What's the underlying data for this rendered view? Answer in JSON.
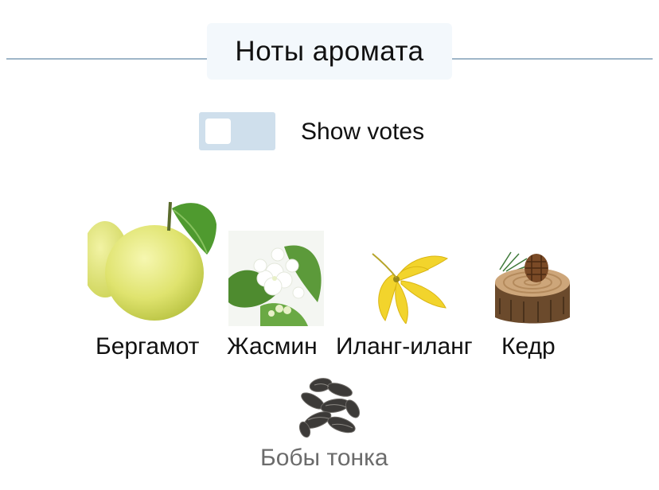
{
  "section": {
    "title": "Ноты аромата"
  },
  "votes_toggle": {
    "label": "Show votes",
    "on": false
  },
  "notes": [
    {
      "name": "Бергамот",
      "icon": "bergamot-image"
    },
    {
      "name": "Жасмин",
      "icon": "jasmine-image"
    },
    {
      "name": "Иланг-иланг",
      "icon": "ylang-ylang-image"
    },
    {
      "name": "Кедр",
      "icon": "cedar-image"
    },
    {
      "name": "Бобы тонка",
      "icon": "tonka-bean-image"
    }
  ]
}
